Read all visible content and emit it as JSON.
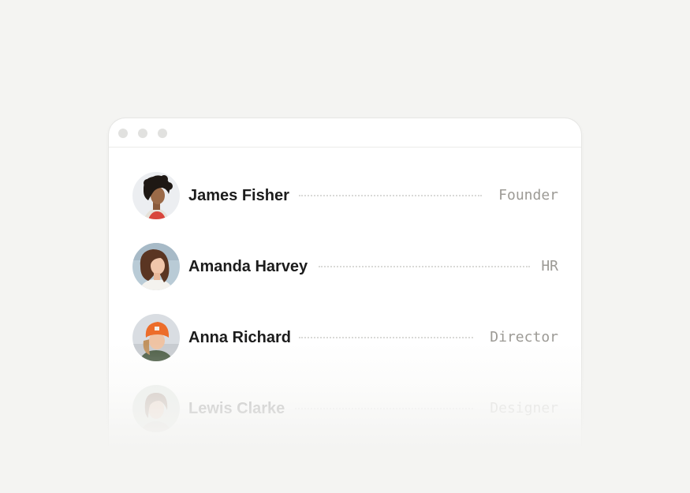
{
  "window": {
    "controls": [
      "dot",
      "dot",
      "dot"
    ]
  },
  "team": [
    {
      "name": "James Fisher",
      "role": "Founder",
      "avatar": "avatar-photo"
    },
    {
      "name": "Amanda Harvey",
      "role": "HR",
      "avatar": "avatar-photo"
    },
    {
      "name": "Anna Richard",
      "role": "Director",
      "avatar": "avatar-photo"
    },
    {
      "name": "Lewis Clarke",
      "role": "Designer",
      "avatar": "avatar-photo"
    }
  ],
  "colors": {
    "background": "#f4f4f2",
    "card": "#ffffff",
    "name_text": "#1c1c1c",
    "role_text": "#9c9a95",
    "leader": "#d9d9d7"
  }
}
